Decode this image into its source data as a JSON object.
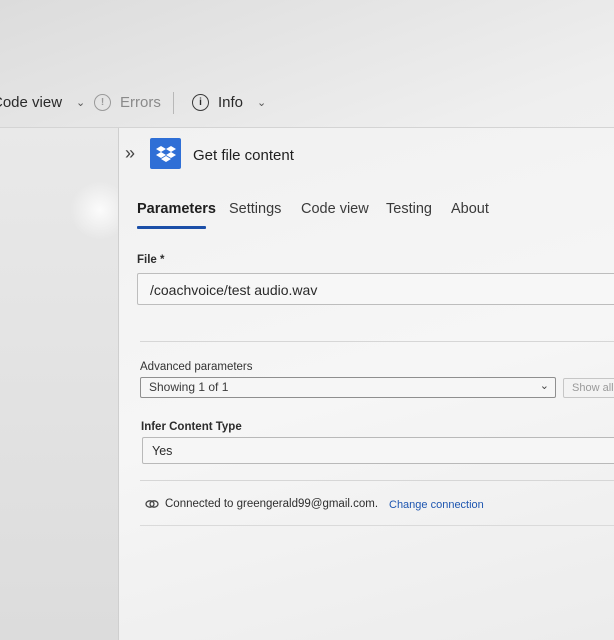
{
  "toolbar": {
    "code_view_label": "Code view",
    "errors_label": "Errors",
    "info_label": "Info",
    "info_glyph": "i",
    "errors_glyph": "!"
  },
  "action": {
    "title": "Get file content",
    "icon": "dropbox-icon",
    "brand_color": "#2f6fd6"
  },
  "tabs": [
    {
      "label": "Parameters",
      "active": true
    },
    {
      "label": "Settings",
      "active": false
    },
    {
      "label": "Code view",
      "active": false
    },
    {
      "label": "Testing",
      "active": false
    },
    {
      "label": "About",
      "active": false
    }
  ],
  "file_field": {
    "label": "File *",
    "value": "/coachvoice/test audio.wav"
  },
  "advanced": {
    "label": "Advanced parameters",
    "selected": "Showing 1 of 1",
    "show_all_label": "Show all"
  },
  "infer_content_type": {
    "label": "Infer Content Type",
    "value": "Yes"
  },
  "connection": {
    "text": "Connected to greengerald99@gmail.com.",
    "change_label": "Change connection"
  },
  "colors": {
    "accent": "#1b4fa8",
    "link": "#1e56b0"
  }
}
